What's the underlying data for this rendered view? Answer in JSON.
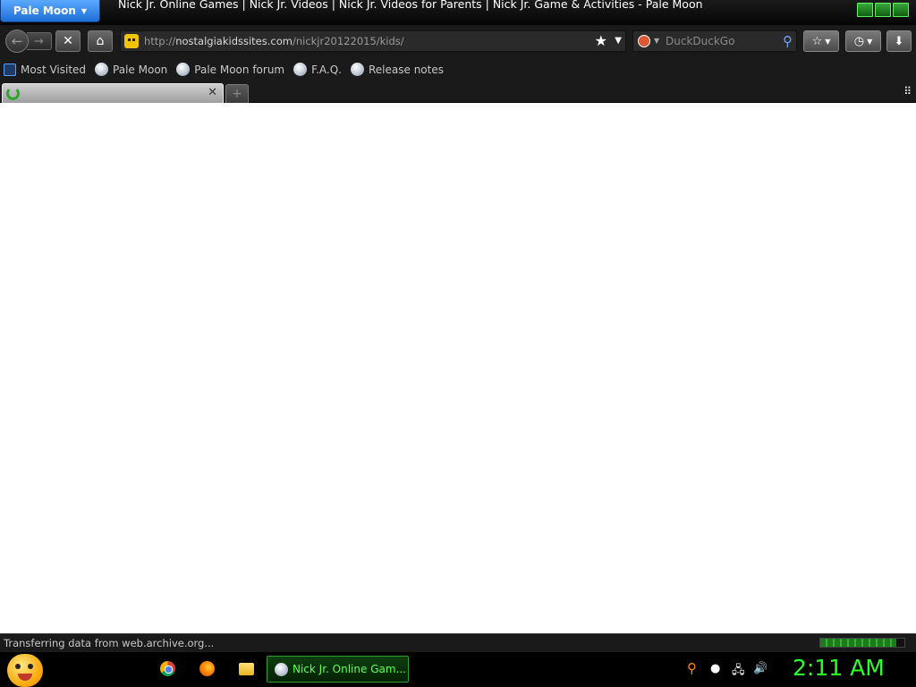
{
  "window": {
    "app_button": "Pale Moon",
    "title": "Nick Jr. Online Games | Nick Jr. Videos | Nick Jr. Videos for Parents | Nick Jr. Game & Activities - Pale Moon"
  },
  "navbar": {
    "url_prefix": "http://",
    "url_host": "nostalgiakidssites.com",
    "url_path": "/nickjr20122015/kids/",
    "search_placeholder": "DuckDuckGo"
  },
  "bookmarks": [
    {
      "label": "Most Visited",
      "icon": "most-visited-icon"
    },
    {
      "label": "Pale Moon",
      "icon": "globe-icon"
    },
    {
      "label": "Pale Moon forum",
      "icon": "globe-icon"
    },
    {
      "label": "F.A.Q.",
      "icon": "globe-icon"
    },
    {
      "label": "Release notes",
      "icon": "globe-icon"
    }
  ],
  "tab": {
    "title": "",
    "loading": true
  },
  "status": {
    "text": "Transferring data from web.archive.org...",
    "progress": 0.9
  },
  "taskbar": {
    "task_label": "Nick Jr. Online Gam...",
    "clock": "2:11 AM"
  },
  "colors": {
    "accent": "#1f6fd6",
    "taskbar_green": "#2dff2d",
    "chrome_dark": "#1a1a1a"
  }
}
